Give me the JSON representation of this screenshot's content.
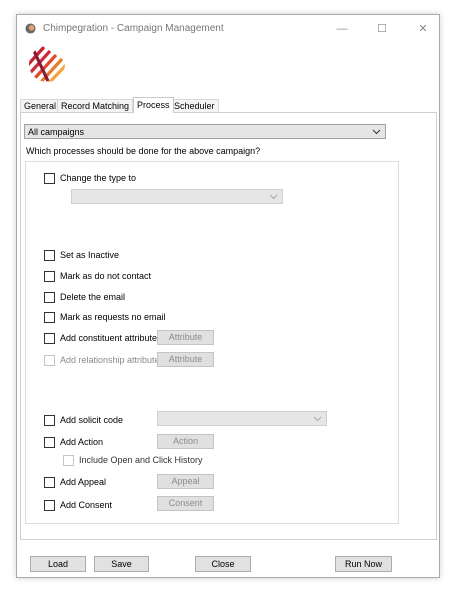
{
  "window": {
    "title": "Chimpegration - Campaign Management",
    "minimize": "—",
    "maximize": "☐",
    "close": "✕"
  },
  "tabs": [
    "General",
    "Record Matching",
    "Process",
    "Scheduler"
  ],
  "campaign_select": {
    "value": "All campaigns"
  },
  "group": {
    "title": "Which processes should be done for the above campaign?",
    "options": {
      "change_type": "Change the type to",
      "set_inactive": "Set as Inactive",
      "do_not_contact": "Mark as do not contact",
      "delete_email": "Delete the email",
      "requests_no_email": "Mark as requests no email",
      "add_constituent_attr": "Add constituent attribute",
      "add_relationship_attr": "Add relationship attribute",
      "add_solicit_code": "Add solicit code",
      "add_action": "Add Action",
      "include_history": "Include Open and Click History",
      "add_appeal": "Add Appeal",
      "add_consent": "Add Consent"
    },
    "buttons": {
      "attribute_constituent": "Attribute",
      "attribute_relationship": "Attribute",
      "action": "Action",
      "appeal": "Appeal",
      "consent": "Consent"
    }
  },
  "footer": {
    "load": "Load",
    "save": "Save",
    "close": "Close",
    "run_now": "Run Now"
  }
}
